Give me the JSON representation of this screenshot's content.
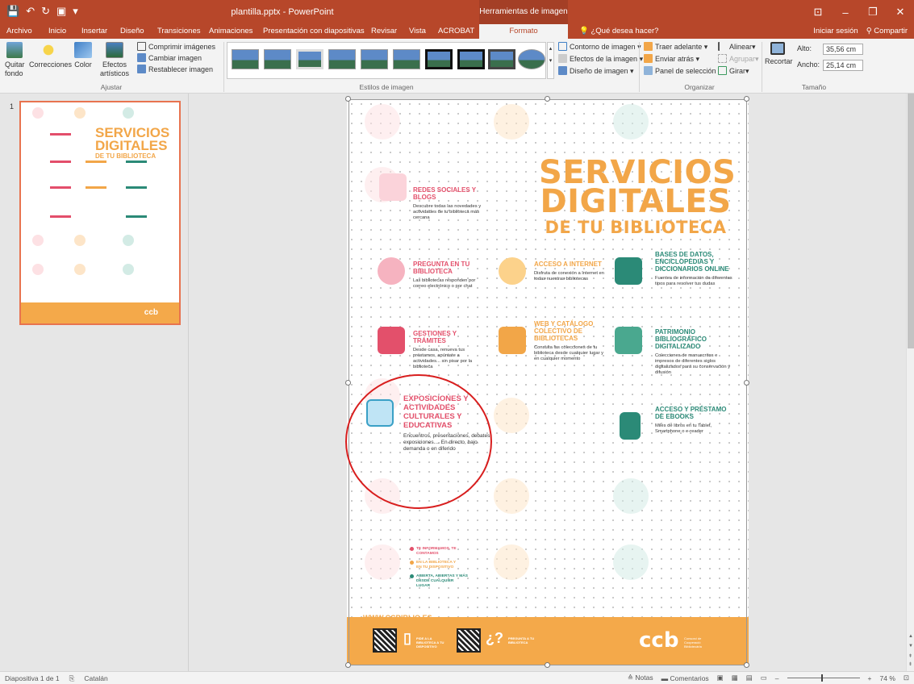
{
  "window": {
    "title": "plantilla.pptx - PowerPoint",
    "context_tab": "Herramientas de imagen"
  },
  "tabs": [
    "Archivo",
    "Inicio",
    "Insertar",
    "Diseño",
    "Transiciones",
    "Animaciones",
    "Presentación con diapositivas",
    "Revisar",
    "Vista",
    "ACROBAT",
    "Formato"
  ],
  "tell_me": "¿Qué desea hacer?",
  "sign_in": "Iniciar sesión",
  "share": "Compartir",
  "ribbon": {
    "quitar_fondo": "Quitar fondo",
    "correcciones": "Correcciones",
    "color": "Color",
    "efectos_artisticos": "Efectos artísticos",
    "comprimir": "Comprimir imágenes",
    "cambiar": "Cambiar imagen",
    "restablecer": "Restablecer imagen",
    "ajustar_label": "Ajustar",
    "estilos_label": "Estilos de imagen",
    "contorno": "Contorno de imagen",
    "efectos": "Efectos de la imagen",
    "diseno": "Diseño de imagen",
    "traer": "Traer adelante",
    "enviar": "Enviar atrás",
    "panel": "Panel de selección",
    "alinear": "Alinear",
    "agrupar": "Agrupar",
    "girar": "Girar",
    "organizar_label": "Organizar",
    "recortar": "Recortar",
    "alto_label": "Alto:",
    "alto_value": "35,56 cm",
    "ancho_label": "Ancho:",
    "ancho_value": "25,14 cm",
    "tamano_label": "Tamaño"
  },
  "thumbnail": {
    "number": "1",
    "title_l1": "SERVICIOS",
    "title_l2": "DIGITALES",
    "title_l3": "DE TU BIBLIOTECA",
    "logo": "ccb"
  },
  "slide": {
    "title_l1": "SERVICIOS",
    "title_l2": "DIGITALES",
    "title_l3": "DE TU BIBLIOTECA",
    "items": [
      {
        "title": "REDES SOCIALES Y BLOGS",
        "desc": "Descubre todas las novedades y actividades de tu biblioteca más cercana"
      },
      {
        "title": "PREGUNTA EN TU BIBLIOTECA",
        "desc": "Las bibliotecas responden por correo electrónico o por chat"
      },
      {
        "title": "ACCESO A INTERNET",
        "desc": "Disfruta de conexión a Internet en todas nuestras bibliotecas"
      },
      {
        "title": "BASES DE DATOS, ENCICLOPEDIAS Y DICCIONARIOS ONLINE",
        "desc": "Fuentes de información de diferentes tipos para resolver tus dudas"
      },
      {
        "title": "GESTIONES Y TRÁMITES",
        "desc": "Desde casa, renueva tus préstamos, apúntate a actividades... sin pisar por la biblioteca"
      },
      {
        "title": "WEB Y CATÁLOGO COLECTIVO DE BIBLIOTECAS",
        "desc": "Consulta las colecciones de tu biblioteca desde cualquier lugar y en cualquier momento"
      },
      {
        "title": "PATRIMONIO BIBLIOGRÁFICO DIGITALIZADO",
        "desc": "Colecciones de manuscritos e impresos de diferentes siglos digitalizados para su conservación y difusión"
      },
      {
        "title": "EXPOSICIONES Y ACTIVIDADES CULTURALES Y EDUCATIVAS",
        "desc": "Encuentros, presentaciones, debates, exposiciones.... En directo, bajo demanda o en diferido"
      },
      {
        "title": "ACCESO Y PRÉSTAMO DE EBOOKS",
        "desc": "Miles de libros en tu Tablet, Smartphone o e-reader"
      }
    ],
    "bullets": [
      {
        "text": "TE INFORMAMOS, TE CONTAMOS",
        "color": "#e3506b"
      },
      {
        "text": "EN LA BIBLIOTECA Y EN TU DISPOSITIVO",
        "color": "#f2a648"
      },
      {
        "text": "ABIERTA, ABIERTAS Y MÁS DESDE CUALQUIER LUGAR",
        "color": "#2b8a77"
      }
    ],
    "url": "WWW.CCBIBLIO.ES",
    "footer": {
      "txt1": "PIDE A LA BIBLIOTECA A TU DISPOSITIVO",
      "txt2": "PREGUNTA A TU BIBLIOTECA",
      "logo": "ccb",
      "logo_txt": "Consorci de Cooperació Bibliotecària"
    }
  },
  "status": {
    "slide_info": "Diapositiva 1 de 1",
    "language": "Catalán",
    "notes": "Notas",
    "comments": "Comentarios",
    "zoom": "74 %"
  }
}
